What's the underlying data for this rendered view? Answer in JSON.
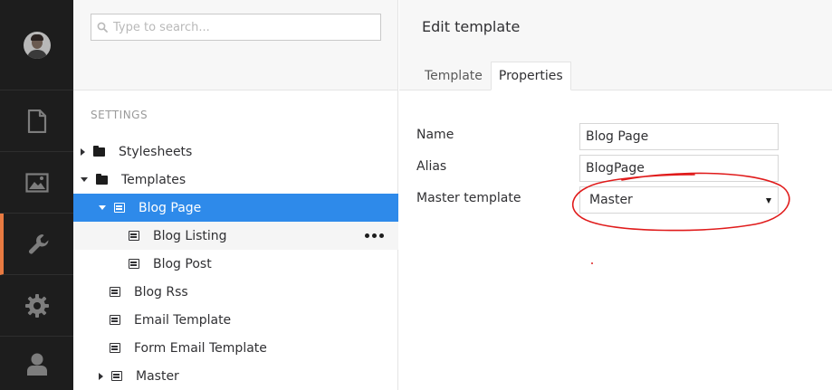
{
  "rail": {
    "items": [
      {
        "name": "user-avatar",
        "icon": "avatar"
      },
      {
        "name": "content",
        "icon": "document-icon"
      },
      {
        "name": "media",
        "icon": "image-icon"
      },
      {
        "name": "settings-section",
        "icon": "wrench-icon",
        "active": true
      },
      {
        "name": "developer",
        "icon": "gear-icon"
      },
      {
        "name": "members",
        "icon": "user-icon"
      }
    ],
    "colors": {
      "background": "#1d1d1d",
      "active_accent": "#e87a41",
      "icon": "#7d7d7d"
    }
  },
  "search": {
    "placeholder": "Type to search..."
  },
  "tree": {
    "section_title": "SETTINGS",
    "items": [
      {
        "label": "Stylesheets",
        "icon": "folder-icon",
        "expanded": false
      },
      {
        "label": "Templates",
        "icon": "folder-icon",
        "expanded": true
      },
      {
        "label": "Blog Page",
        "icon": "template-icon",
        "expanded": true,
        "selected": true
      },
      {
        "label": "Blog Listing",
        "icon": "template-icon",
        "hover": true,
        "actions": "more-options-icon"
      },
      {
        "label": "Blog Post",
        "icon": "template-icon"
      },
      {
        "label": "Blog Rss",
        "icon": "template-icon"
      },
      {
        "label": "Email Template",
        "icon": "template-icon"
      },
      {
        "label": "Form Email Template",
        "icon": "template-icon"
      },
      {
        "label": "Master",
        "icon": "template-icon",
        "expanded": false
      }
    ],
    "selected_color": "#2e8aea"
  },
  "editor": {
    "title": "Edit template",
    "tabs": [
      {
        "label": "Template",
        "active": false
      },
      {
        "label": "Properties",
        "active": true
      }
    ],
    "fields": {
      "name": {
        "label": "Name",
        "value": "Blog Page"
      },
      "alias": {
        "label": "Alias",
        "value": "BlogPage"
      },
      "master": {
        "label": "Master template",
        "value": "Master"
      }
    },
    "annotation_color": "#e01b1b"
  }
}
